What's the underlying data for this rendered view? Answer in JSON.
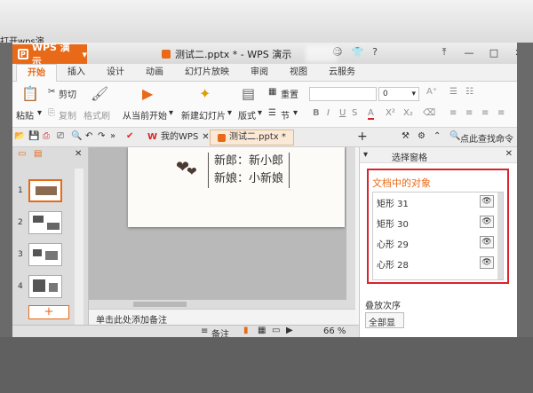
{
  "window": {
    "app_name": "WPS 演示",
    "title": "测试二.pptx * - WPS 演示",
    "logo_letter": "P",
    "title_icons": [
      "shirt-icon",
      "help-icon",
      "minimize-icon",
      "maximize-icon",
      "close-icon"
    ],
    "help_label": "?",
    "controls": [
      "⤒",
      "—",
      "□",
      "✕"
    ]
  },
  "background": {
    "snippet": "打开wps演"
  },
  "ribbon_tabs": [
    "开始",
    "插入",
    "设计",
    "动画",
    "幻灯片放映",
    "审阅",
    "视图",
    "云服务"
  ],
  "active_tab": "开始",
  "ribbon": {
    "paste": "粘贴",
    "cut": "剪切",
    "copy": "复制",
    "format_painter": "格式刷",
    "play_from_current": "从当前开始",
    "new_slide": "新建幻灯片",
    "layout": "版式",
    "reset": "重置",
    "section": "节",
    "font_size": "0",
    "bold": "B",
    "italic": "I",
    "underline": "U",
    "font_color": "A",
    "superscript": "X²",
    "subscript": "X₂"
  },
  "quick_access": {
    "doc_tabs": [
      {
        "label": "我的WPS",
        "icon": "wps-logo-icon"
      },
      {
        "label": "测试二.pptx *",
        "icon": "presentation-icon"
      }
    ],
    "new_tab": "+",
    "search": "点此查找命令"
  },
  "thumbnails": [
    "1",
    "2",
    "3",
    "4"
  ],
  "add_slide": "+",
  "slide": {
    "line1": "新郎：新小郎",
    "line2": "新娘：小新娘"
  },
  "notes_placeholder": "单击此处添加备注",
  "selection_pane": {
    "title": "选择窗格",
    "section_title": "文档中的对象",
    "objects": [
      "矩形 31",
      "矩形 30",
      "心形 29",
      "心形 28"
    ],
    "order_label": "叠放次序",
    "show_all": "全部显"
  },
  "statusbar": {
    "notes": "备注",
    "zoom": "66 %"
  },
  "colors": {
    "accent": "#e86a18",
    "highlight_border": "#d8242a"
  }
}
